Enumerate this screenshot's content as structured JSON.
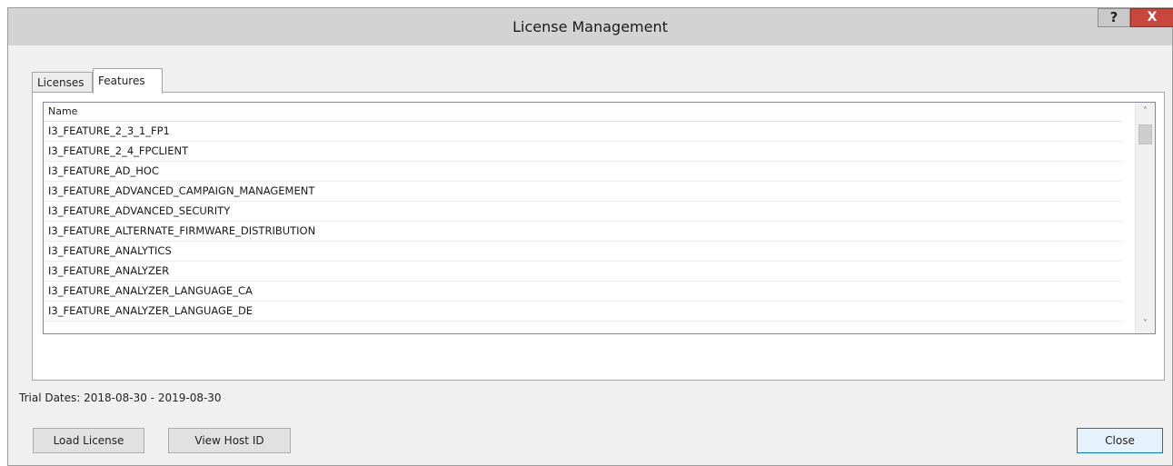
{
  "window": {
    "title": "License Management",
    "help_label": "?",
    "close_label": "X"
  },
  "tabs": [
    {
      "label": "Licenses",
      "active": false
    },
    {
      "label": "Features",
      "active": true
    }
  ],
  "features_list": {
    "column_header": "Name",
    "rows": [
      "I3_FEATURE_2_3_1_FP1",
      "I3_FEATURE_2_4_FPCLIENT",
      "I3_FEATURE_AD_HOC",
      "I3_FEATURE_ADVANCED_CAMPAIGN_MANAGEMENT",
      "I3_FEATURE_ADVANCED_SECURITY",
      "I3_FEATURE_ALTERNATE_FIRMWARE_DISTRIBUTION",
      "I3_FEATURE_ANALYTICS",
      "I3_FEATURE_ANALYZER",
      "I3_FEATURE_ANALYZER_LANGUAGE_CA",
      "I3_FEATURE_ANALYZER_LANGUAGE_DE"
    ],
    "scroll_up_icon": "chevron-up-icon",
    "scroll_down_icon": "chevron-down-icon"
  },
  "trial_dates": "Trial Dates: 2018-08-30 - 2019-08-30",
  "buttons": {
    "load_license": "Load License",
    "view_host_id": "View Host ID",
    "close": "Close"
  },
  "colors": {
    "titlebar": "#d3d3d3",
    "close_button": "#c8463d",
    "dialog_background": "#f0f0f0",
    "default_button_border": "#0078d7"
  }
}
